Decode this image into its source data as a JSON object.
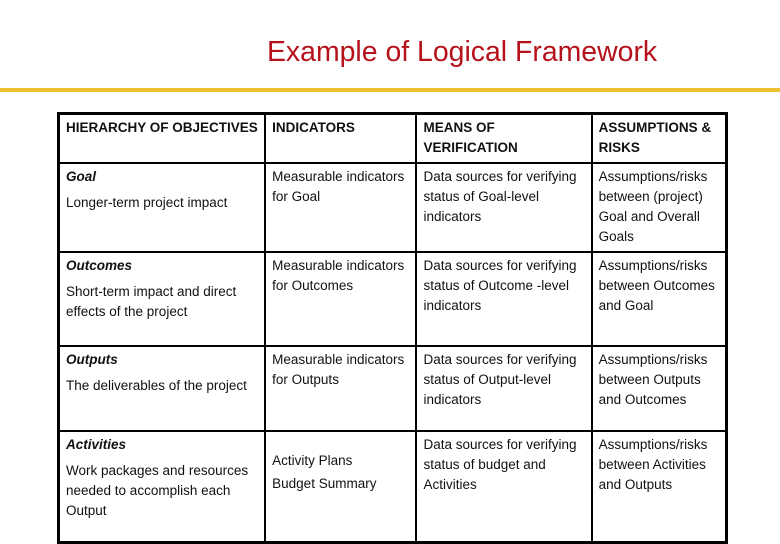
{
  "title": "Example of Logical Framework",
  "table": {
    "headers": [
      "HIERARCHY OF OBJECTIVES",
      "INDICATORS",
      "MEANS OF VERIFICATION",
      "ASSUMPTIONS & RISKS"
    ],
    "rows": [
      {
        "level": "Goal",
        "description": "Longer-term project impact",
        "indicators": [
          "Measurable indicators for Goal"
        ],
        "verification": "Data sources for verifying status of Goal-level indicators",
        "assumptions": "Assumptions/risks between (project) Goal and Overall Goals"
      },
      {
        "level": "Outcomes",
        "description": "Short-term impact and direct effects of the project",
        "indicators": [
          "Measurable indicators for Outcomes"
        ],
        "verification": "Data sources for verifying status of Outcome -level indicators",
        "assumptions": "Assumptions/risks between Outcomes and Goal"
      },
      {
        "level": "Outputs",
        "description": "The deliverables of the project",
        "indicators": [
          "Measurable indicators for Outputs"
        ],
        "verification": "Data sources for verifying status of Output-level indicators",
        "assumptions": "Assumptions/risks between Outputs and Outcomes"
      },
      {
        "level": "Activities",
        "description": "Work packages and resources needed to accomplish each Output",
        "indicators": [
          "Activity Plans",
          "Budget Summary"
        ],
        "verification": "Data sources for verifying status of budget and Activities",
        "assumptions": "Assumptions/risks between Activities and Outputs"
      }
    ]
  },
  "colors": {
    "title": "#b5121b",
    "rule": "#ecc232"
  }
}
